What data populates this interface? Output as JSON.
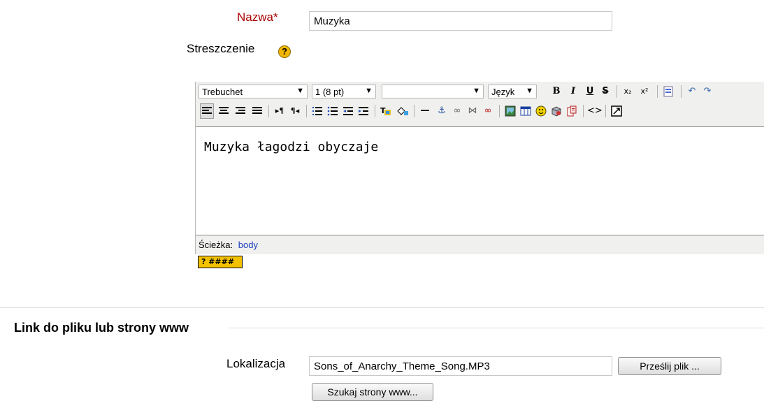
{
  "form": {
    "name_label": "Nazwa",
    "required_mark": "*",
    "name_value": "Muzyka",
    "summary_label": "Streszczenie",
    "help_glyph": "?"
  },
  "editor": {
    "font_family": "Trebuchet",
    "font_size": "1 (8 pt)",
    "format": "",
    "language": "Język",
    "content": "Muzyka łagodzi obyczaje",
    "path_label": "Ścieżka:",
    "path_value": "body",
    "keyboard_help_text": "? ####"
  },
  "section": {
    "legend": "Link do pliku lub strony www",
    "location_label": "Lokalizacja",
    "location_value": "Sons_of_Anarchy_Theme_Song.MP3",
    "upload_button": "Prześlij plik ...",
    "search_button": "Szukaj strony www..."
  },
  "icons": {
    "bold": "B",
    "italic": "I",
    "underline": "U",
    "strike": "S",
    "subscript": "x₂",
    "superscript": "x²"
  }
}
